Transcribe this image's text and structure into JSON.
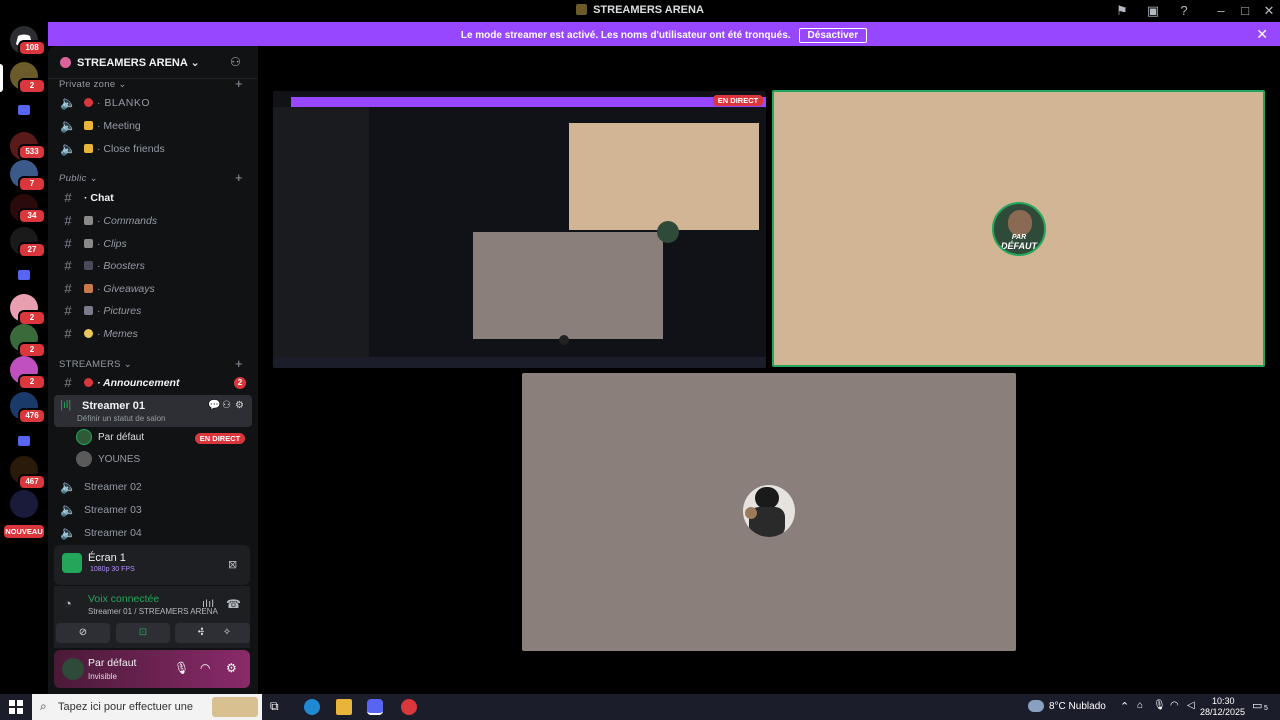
{
  "window": {
    "title": "STREAMERS ARENA"
  },
  "rail": {
    "badges": [
      "108",
      "2",
      "533",
      "7",
      "34",
      "27",
      "2",
      "2",
      "2",
      "476",
      "467"
    ],
    "new_label": "NOUVEAU"
  },
  "banner": {
    "message": "Le mode streamer est activé. Les noms d'utilisateur ont été tronqués.",
    "button": "Désactiver"
  },
  "server": {
    "name": "STREAMERS ARENA"
  },
  "categories": {
    "private": "Private zone",
    "public": "Public",
    "streamers": "STREAMERS"
  },
  "private_channels": [
    "BLANKO",
    "Meeting",
    "Close friends"
  ],
  "public_channels": [
    "Chat",
    "Commands",
    "Clips",
    "Boosters",
    "Giveaways",
    "Pictures",
    "Memes"
  ],
  "streamers": {
    "announcement": "Announcement",
    "announcement_badge": "2",
    "active_channel": "Streamer 01",
    "active_status": "Définir un statut de salon",
    "users": [
      "Par défaut",
      "YOUNES"
    ],
    "live_label": "EN DIRECT",
    "other_channels": [
      "Streamer 02",
      "Streamer 03",
      "Streamer 04"
    ]
  },
  "screen_share": {
    "title": "Écran 1",
    "quality": "1080p 30 FPS"
  },
  "voice": {
    "status": "Voix connectée",
    "channel": "Streamer 01 / STREAMERS ARENA"
  },
  "user": {
    "name": "Par défaut",
    "status": "Invisible"
  },
  "stage": {
    "live_label": "EN DIRECT",
    "avatar_caption_top": "PAR",
    "avatar_caption_bottom": "DÉFAUT"
  },
  "taskbar": {
    "search_placeholder": "Tapez ici pour effectuer une",
    "weather": "8°C  Nublado",
    "time": "10:30",
    "date": "28/12/2025",
    "notif": "5"
  },
  "colors": {
    "accent": "#9747ff",
    "live": "#da373c",
    "online": "#23a55a",
    "tile_tan": "#d2b595",
    "tile_grey": "#8b7f7b"
  }
}
